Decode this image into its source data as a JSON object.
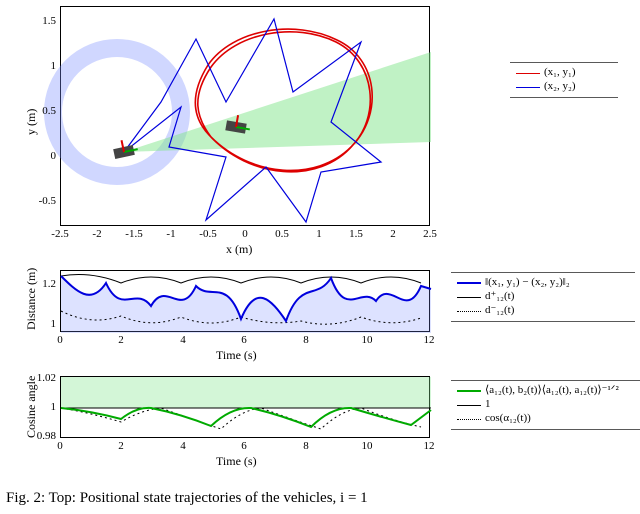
{
  "caption": "Fig. 2: Top: Positional state trajectories of the vehicles, i = 1",
  "topPlot": {
    "xlabel": "x (m)",
    "ylabel": "y (m)",
    "xticks": [
      "-2.5",
      "-2",
      "-1.5",
      "-1",
      "-0.5",
      "0",
      "0.5",
      "1",
      "1.5",
      "2",
      "2.5"
    ],
    "yticks": [
      "-0.5",
      "0",
      "0.5",
      "1",
      "1.5"
    ]
  },
  "legendTop": {
    "row1": "(x₁, y₁)",
    "row2": "(x₂, y₂)"
  },
  "midPlot": {
    "xlabel": "Time (s)",
    "ylabel": "Distance (m)",
    "xticks": [
      "0",
      "2",
      "4",
      "6",
      "8",
      "10",
      "12"
    ],
    "yticks": [
      "1",
      "1.2"
    ]
  },
  "legendMid": {
    "row1": "‖(x₁, y₁) − (x₂, y₂)‖₂",
    "row2": "d⁺₁₂(t)",
    "row3": "d⁻₁₂(t)"
  },
  "botPlot": {
    "xlabel": "Time (s)",
    "ylabel": "Cosine angle",
    "xticks": [
      "0",
      "2",
      "4",
      "6",
      "8",
      "10",
      "12"
    ],
    "yticks": [
      "0.98",
      "1",
      "1.02"
    ]
  },
  "legendBot": {
    "row1": "⟨a₁₂(t), b₂(t)⟩⟨a₁₂(t), a₁₂(t)⟩⁻¹ᐟ²",
    "row2": "1",
    "row3": "cos(α₁₂(t))"
  },
  "chart_data": [
    {
      "type": "line",
      "title": "Positional state trajectories",
      "xlabel": "x (m)",
      "ylabel": "y (m)",
      "xlim": [
        -2.5,
        2.5
      ],
      "ylim": [
        -0.7,
        1.7
      ],
      "series": [
        {
          "name": "(x1,y1)",
          "color": "#d00",
          "x": [
            -0.6,
            0.2,
            0.8,
            1.1,
            1.0,
            0.6,
            0.0,
            -0.4,
            -0.7,
            -0.6,
            -0.2,
            0.4,
            0.9,
            1.05,
            0.8,
            0.2,
            -0.3,
            -0.65,
            -0.6
          ],
          "y": [
            0.4,
            0.15,
            0.3,
            0.7,
            1.1,
            1.25,
            1.2,
            0.9,
            0.55,
            0.35,
            0.18,
            0.18,
            0.45,
            0.9,
            1.2,
            1.25,
            1.05,
            0.7,
            0.4
          ]
        },
        {
          "name": "(x2,y2)",
          "color": "#00d",
          "x": [
            -1.7,
            -1.2,
            -0.7,
            -0.2,
            0.3,
            -0.1,
            0.4,
            0.9,
            1.4,
            0.9,
            0.4,
            0.75,
            0.25,
            -0.25,
            -0.9,
            -0.3,
            -0.8,
            -1.05,
            -1.7
          ],
          "y": [
            0.35,
            0.8,
            1.3,
            1.7,
            1.3,
            0.7,
            1.1,
            1.55,
            1.1,
            0.6,
            0.05,
            -0.15,
            0.3,
            -0.1,
            0.05,
            0.45,
            0.8,
            0.35,
            0.35
          ]
        }
      ],
      "annotations": [
        "light-blue reference ring centered near (-1.8,0.5) radius≈0.7, thickness≈0.2",
        "light-green sensing cone from vehicle near (-1.7,0.35) toward (1.6,0.9)"
      ]
    },
    {
      "type": "line",
      "title": "Distance vs time",
      "xlabel": "Time (s)",
      "ylabel": "Distance (m)",
      "xlim": [
        0,
        12
      ],
      "ylim": [
        0.85,
        1.3
      ],
      "series": [
        {
          "name": "||p1-p2||_2",
          "color": "#00d",
          "x": [
            0,
            0.5,
            1,
            1.5,
            2,
            2.5,
            3,
            3.5,
            4,
            4.5,
            5,
            5.5,
            6,
            6.5,
            7,
            7.5,
            8,
            8.5,
            9,
            9.5,
            10,
            10.5,
            11,
            11.5,
            12
          ],
          "y": [
            1.23,
            1.15,
            1.05,
            1.2,
            0.95,
            1.18,
            1.05,
            1.23,
            0.92,
            1.17,
            1.1,
            1.24,
            0.95,
            1.2,
            1.12,
            0.95,
            1.22,
            1.07,
            1.24,
            0.96,
            1.19,
            1.1,
            1.24,
            0.97,
            1.2
          ]
        },
        {
          "name": "d12+",
          "color": "#000",
          "x": [
            0,
            1,
            2,
            3,
            4,
            5,
            6,
            7,
            8,
            9,
            10,
            11,
            12
          ],
          "y": [
            1.25,
            1.17,
            1.25,
            1.17,
            1.25,
            1.17,
            1.25,
            1.17,
            1.25,
            1.17,
            1.25,
            1.17,
            1.25
          ]
        },
        {
          "name": "d12-",
          "color": "#000_dotted",
          "x": [
            0,
            1,
            2,
            3,
            4,
            5,
            6,
            7,
            8,
            9,
            10,
            11,
            12
          ],
          "y": [
            1.0,
            0.9,
            0.97,
            0.88,
            0.96,
            0.88,
            0.96,
            0.9,
            0.92,
            0.88,
            0.96,
            0.89,
            0.96
          ]
        }
      ]
    },
    {
      "type": "line",
      "title": "Cosine angle vs time",
      "xlabel": "Time (s)",
      "ylabel": "Cosine angle",
      "xlim": [
        0,
        12
      ],
      "ylim": [
        0.98,
        1.02
      ],
      "series": [
        {
          "name": "<a,b>/|a|",
          "color": "#0a0",
          "x": [
            0,
            1,
            2,
            3,
            4,
            5,
            6,
            7,
            8,
            9,
            10,
            11,
            12
          ],
          "y": [
            1,
            0.998,
            0.992,
            1,
            0.994,
            0.986,
            1,
            0.994,
            0.986,
            1,
            0.993,
            0.988,
            1
          ]
        },
        {
          "name": "1",
          "color": "#000",
          "x": [
            0,
            12
          ],
          "y": [
            1,
            1
          ]
        },
        {
          "name": "cos(alpha12)",
          "color": "#000_dotted",
          "x": [
            0,
            1,
            2,
            3,
            4,
            5,
            6,
            7,
            8,
            9,
            10,
            11,
            12
          ],
          "y": [
            1,
            0.996,
            0.99,
            0.997,
            0.992,
            0.985,
            0.997,
            0.992,
            0.985,
            0.998,
            0.991,
            0.986,
            0.998
          ]
        }
      ]
    }
  ]
}
